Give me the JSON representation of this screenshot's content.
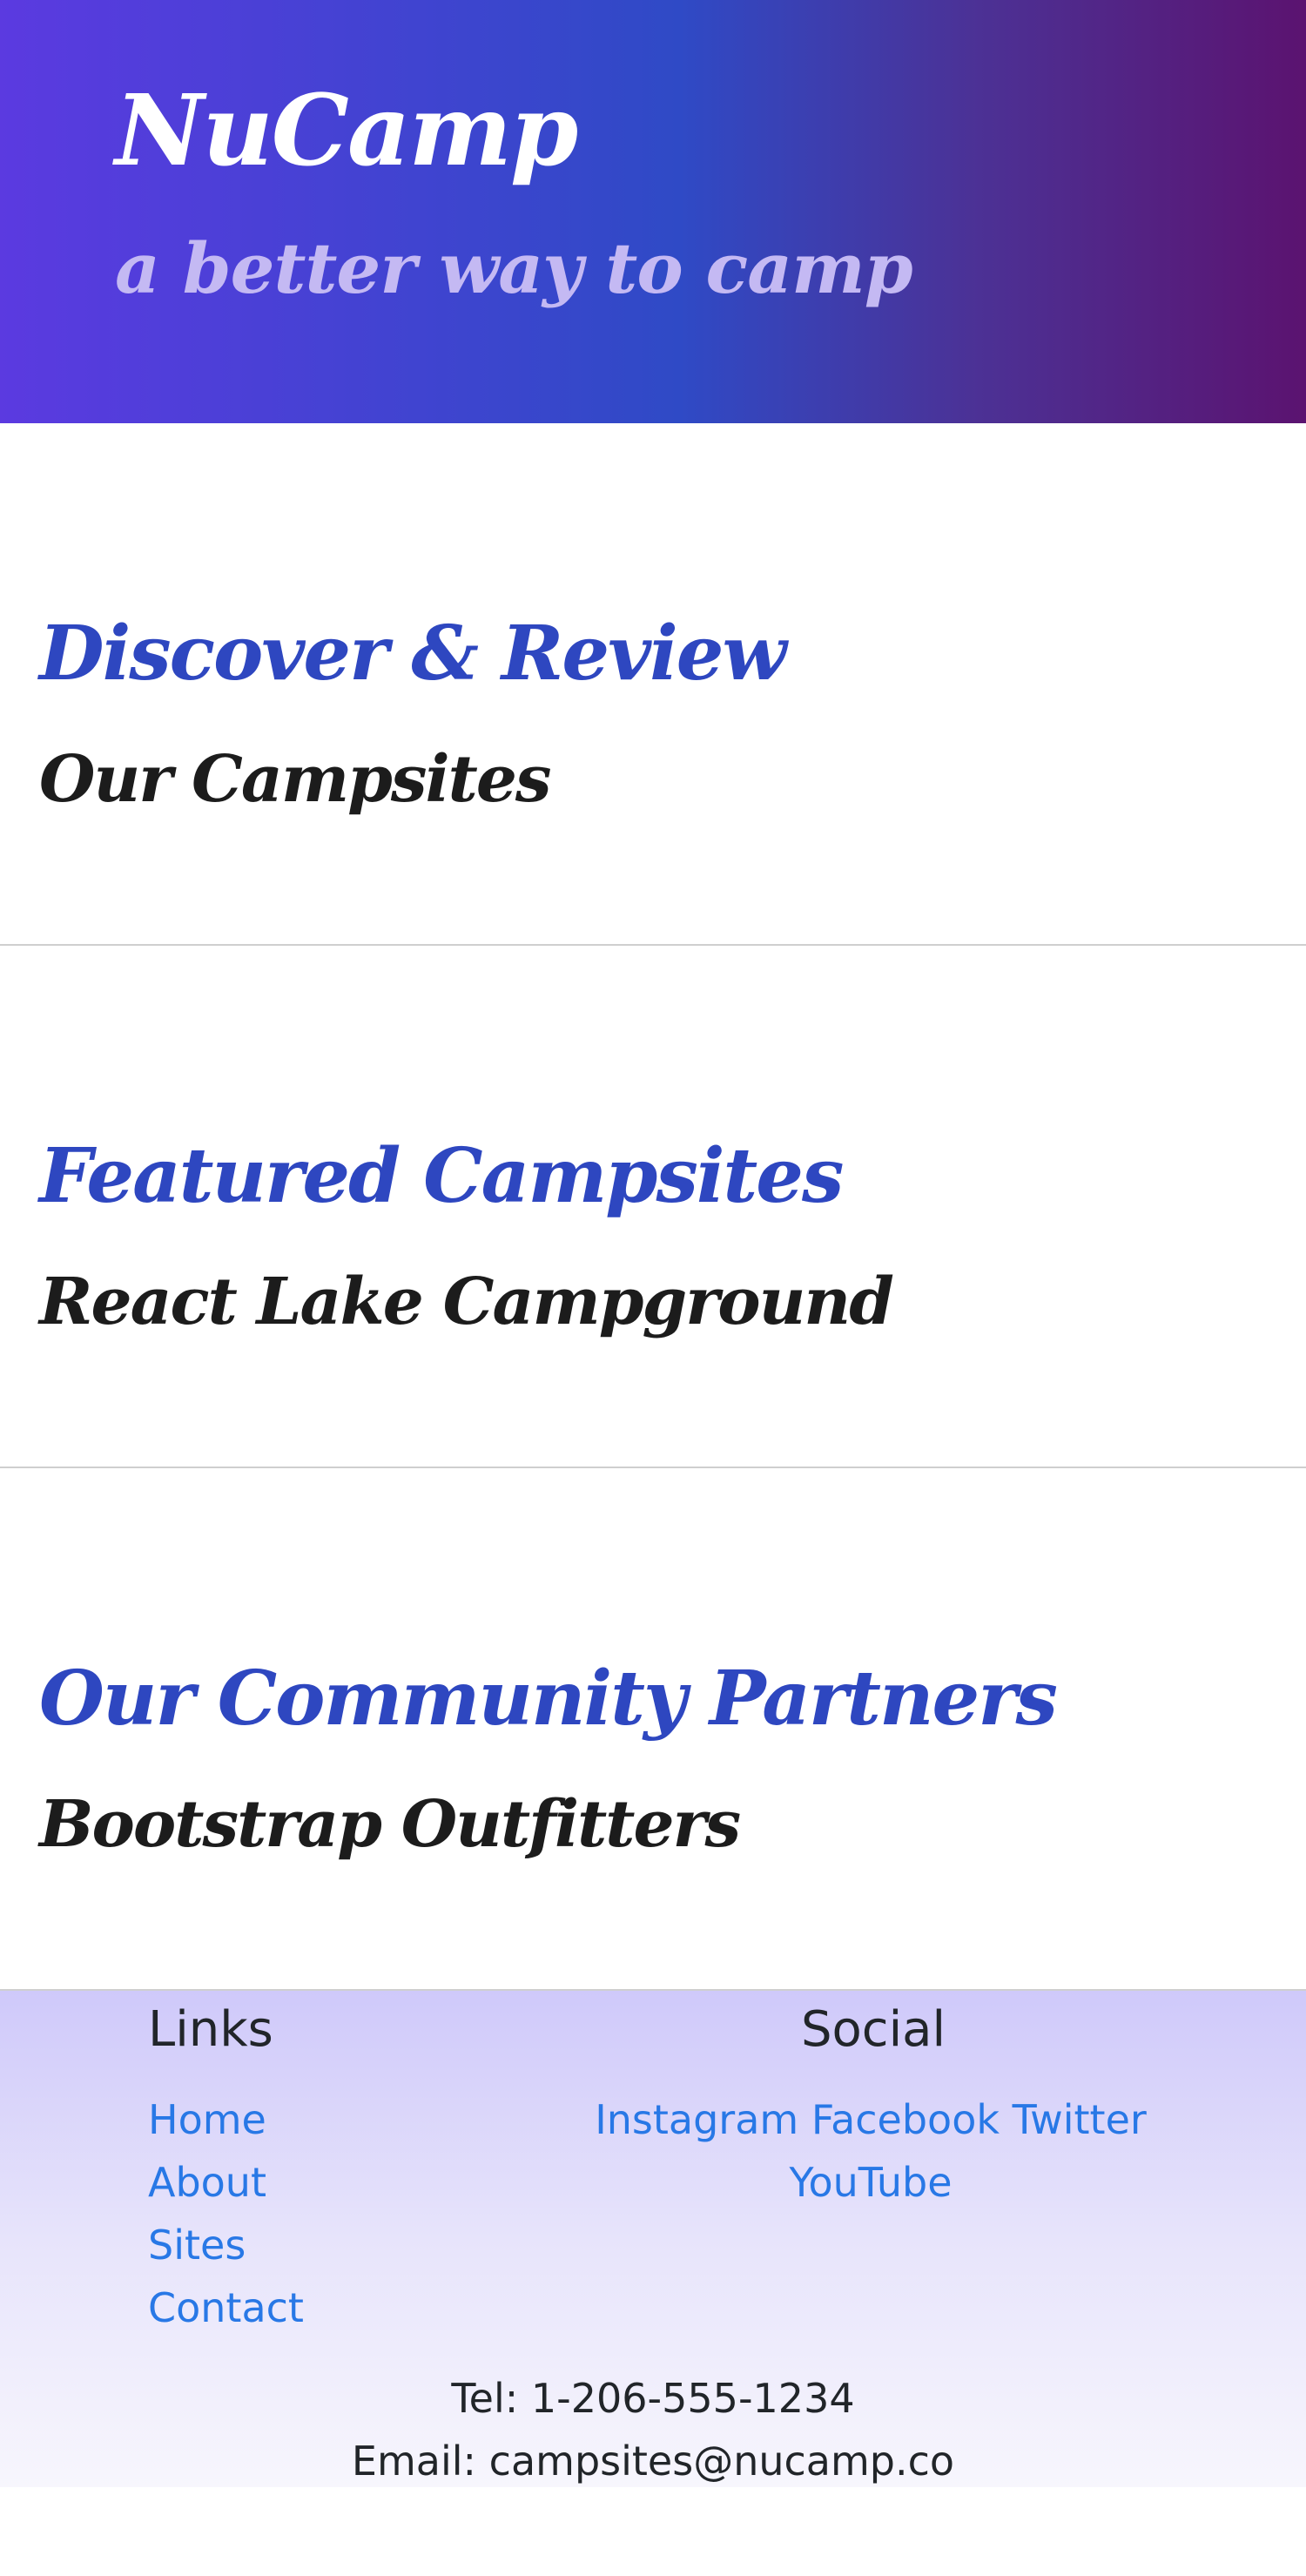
{
  "header": {
    "title": "NuCamp",
    "tagline": "a better way to camp"
  },
  "sections": [
    {
      "heading": "Discover & Review",
      "subheading": "Our Campsites"
    },
    {
      "heading": "Featured Campsites",
      "subheading": "React Lake Campground"
    },
    {
      "heading": "Our Community Partners",
      "subheading": "Bootstrap Outfitters"
    }
  ],
  "footer": {
    "links_title": "Links",
    "links": [
      "Home",
      "About",
      "Sites",
      "Contact"
    ],
    "social_title": "Social",
    "social": [
      "Instagram",
      "Facebook",
      "Twitter",
      "YouTube"
    ],
    "tel": "Tel: 1-206-555-1234",
    "email": "Email: campsites@nucamp.co"
  },
  "colors": {
    "heading_accent": "#2e47c0",
    "link": "#2878e6",
    "tagline": "#c4b9f3"
  }
}
